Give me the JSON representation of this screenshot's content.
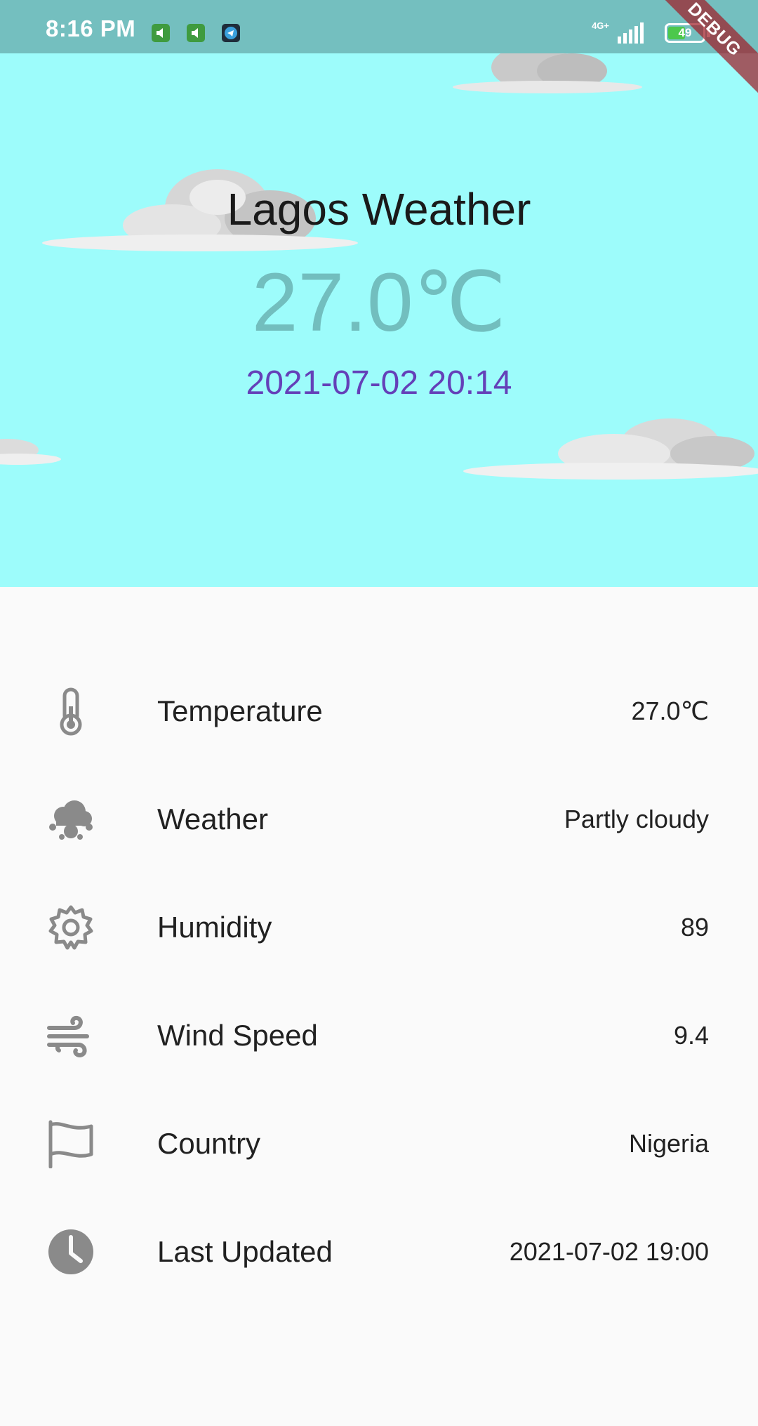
{
  "status_bar": {
    "time": "8:16 PM",
    "network": "4G+",
    "battery_level": "49",
    "battery_fraction": 0.49
  },
  "debug_banner": "DEBUG",
  "header": {
    "city_title": "Lagos Weather",
    "temperature": "27.0℃",
    "local_time": "2021-07-02 20:14",
    "colors": {
      "sky": "#9dfcfb",
      "temperature": "#72bebe",
      "date": "#6440b8"
    }
  },
  "details": [
    {
      "icon": "thermometer-icon",
      "label": "Temperature",
      "value": "27.0℃"
    },
    {
      "icon": "cloud-weather-icon",
      "label": "Weather",
      "value": "Partly cloudy"
    },
    {
      "icon": "gear-icon",
      "label": "Humidity",
      "value": "89"
    },
    {
      "icon": "wind-icon",
      "label": "Wind Speed",
      "value": "9.4"
    },
    {
      "icon": "flag-icon",
      "label": "Country",
      "value": "Nigeria"
    },
    {
      "icon": "clock-icon",
      "label": "Last Updated",
      "value": "2021-07-02 19:00"
    }
  ]
}
